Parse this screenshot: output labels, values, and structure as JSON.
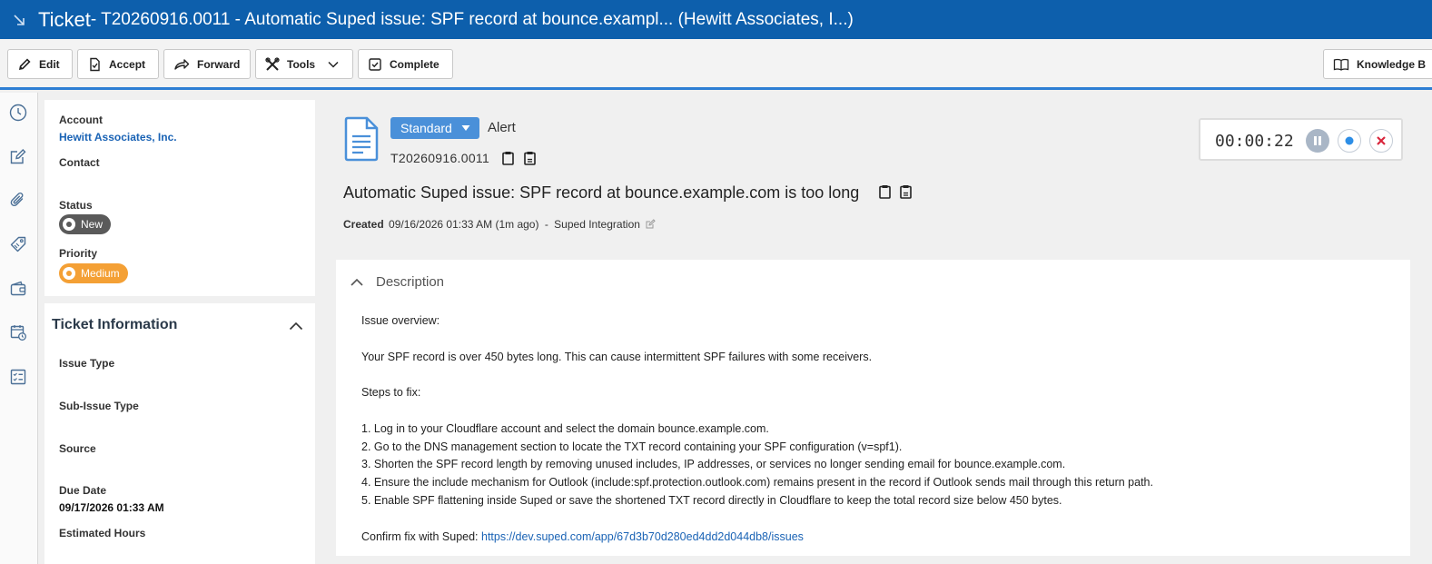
{
  "title": {
    "word": "Ticket",
    "rest": " - T20260916.0011 - Automatic Suped issue: SPF record at bounce.exampl... (Hewitt Associates, I...)"
  },
  "toolbar": {
    "edit": "Edit",
    "accept": "Accept",
    "forward": "Forward",
    "tools": "Tools",
    "complete": "Complete",
    "knowledge": "Knowledge B"
  },
  "summary": {
    "account_label": "Account",
    "account_value": "Hewitt Associates, Inc.",
    "contact_label": "Contact",
    "status_label": "Status",
    "status_value": "New",
    "priority_label": "Priority",
    "priority_value": "Medium"
  },
  "ticket_info": {
    "heading": "Ticket Information",
    "issue_type": "Issue Type",
    "sub_issue_type": "Sub-Issue Type",
    "source": "Source",
    "due_date_label": "Due Date",
    "due_date_value": "09/17/2026 01:33 AM",
    "estimated_hours": "Estimated Hours"
  },
  "header": {
    "category": "Standard",
    "type": "Alert",
    "ticket_number": "T20260916.0011",
    "ticket_title": "Automatic Suped issue: SPF record at bounce.example.com is too long",
    "created_label": "Created",
    "created_value": "09/16/2026 01:33 AM (1m ago)",
    "separator": "-",
    "created_by": "Suped Integration"
  },
  "timer": {
    "value": "00:00:22"
  },
  "description": {
    "heading": "Description",
    "lines": [
      "Issue overview:",
      "",
      "Your SPF record is over 450 bytes long. This can cause intermittent SPF failures with some receivers.",
      "",
      "Steps to fix:",
      "",
      "1. Log in to your Cloudflare account and select the domain bounce.example.com.",
      "2. Go to the DNS management section to locate the TXT record containing your SPF configuration (v=spf1).",
      "3. Shorten the SPF record length by removing unused includes, IP addresses, or services no longer sending email for bounce.example.com.",
      "4. Ensure the include mechanism for Outlook (include:spf.protection.outlook.com) remains present in the record if Outlook sends mail through this return path.",
      "5. Enable SPF flattening inside Suped or save the shortened TXT record directly in Cloudflare to keep the total record size below 450 bytes.",
      ""
    ],
    "confirm_prefix": "Confirm fix with Suped: ",
    "confirm_link": "https://dev.suped.com/app/67d3b70d280ed4dd2d044db8/issues"
  },
  "colors": {
    "titlebar": "#0d5fac",
    "accent": "#2d7ed4",
    "status_new": "#5a5a5a",
    "priority_medium": "#f4a035",
    "link": "#1a63b5"
  }
}
